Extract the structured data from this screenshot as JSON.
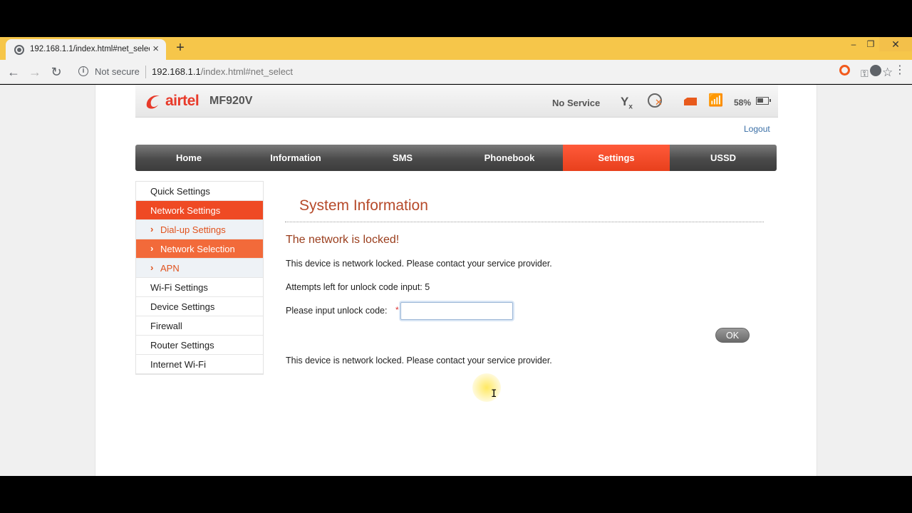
{
  "browser": {
    "tab_title": "192.168.1.1/index.html#net_selec",
    "tab_close": "×",
    "new_tab": "+",
    "window_min": "–",
    "window_max": "❐",
    "window_close": "✕",
    "security_label": "Not secure",
    "url_host": "192.168.1.1",
    "url_path": "/index.html#net_select",
    "icons": [
      "back-arrow-icon",
      "forward-arrow-icon",
      "reload-icon",
      "info-icon",
      "key-icon",
      "star-icon",
      "opera-icon",
      "profile-icon",
      "menu-icon"
    ]
  },
  "header": {
    "brand": "airtel",
    "model": "MF920V",
    "network_status": "No Service",
    "battery_percent": "58%",
    "battery_level": 0.58,
    "brand_color": "#e83a2a"
  },
  "logout_label": "Logout",
  "nav": {
    "items": [
      "Home",
      "Information",
      "SMS",
      "Phonebook",
      "Settings",
      "USSD"
    ],
    "active": "Settings",
    "accent_color": "#e8401c"
  },
  "sidebar": {
    "items": [
      {
        "label": "Quick Settings"
      },
      {
        "label": "Network Settings"
      },
      {
        "label": "Dial-up Settings"
      },
      {
        "label": "Network Selection"
      },
      {
        "label": "APN"
      },
      {
        "label": "Wi-Fi Settings"
      },
      {
        "label": "Device Settings"
      },
      {
        "label": "Firewall"
      },
      {
        "label": "Router Settings"
      },
      {
        "label": "Internet Wi-Fi"
      }
    ]
  },
  "content": {
    "title": "System Information",
    "locked_heading": "The network is locked!",
    "message": "This device is network locked. Please contact your service provider.",
    "attempts_label": "Attempts left for unlock code input: 5",
    "unlock_label": "Please input unlock code:",
    "required_mark": "*",
    "unlock_value": "",
    "ok_label": "OK",
    "message_bottom": "This device is network locked. Please contact your service provider."
  }
}
